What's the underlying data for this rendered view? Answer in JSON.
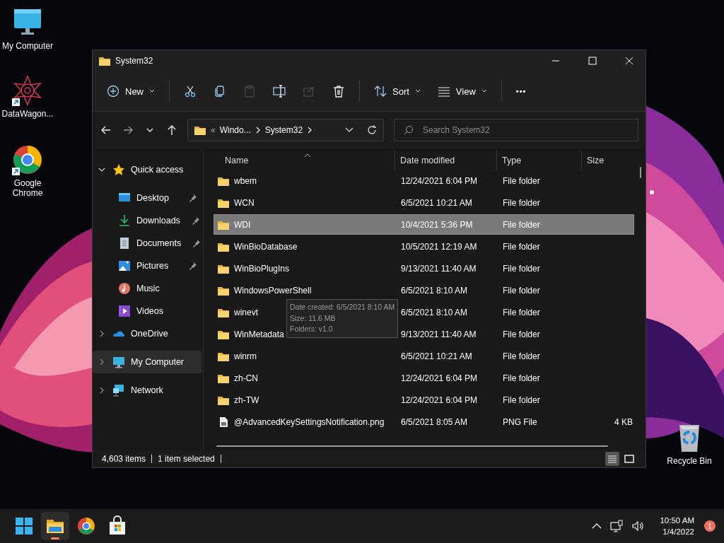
{
  "desktop_icons": [
    {
      "label": "My Computer",
      "shortcut": false
    },
    {
      "label": "DataWagon...",
      "shortcut": true
    },
    {
      "label": "Google Chrome",
      "shortcut": true
    },
    {
      "label": "Recycle Bin",
      "shortcut": false
    }
  ],
  "window": {
    "title": "System32",
    "toolbar": [
      {
        "label": "New",
        "menu": true,
        "disabled": false
      },
      {
        "menu": false,
        "disabled": false
      },
      {
        "menu": false,
        "disabled": false
      },
      {
        "menu": false,
        "disabled": true
      },
      {
        "menu": false,
        "disabled": false
      },
      {
        "menu": false,
        "disabled": true
      },
      {
        "menu": false,
        "disabled": false
      },
      {
        "label": "Sort",
        "menu": true,
        "disabled": false
      },
      {
        "label": "View",
        "menu": true,
        "disabled": false
      },
      {
        "label": "•••",
        "menu": false,
        "disabled": false
      }
    ],
    "address": {
      "overflow": "«",
      "segments": [
        "Windo...",
        "System32"
      ]
    },
    "search": {
      "placeholder": "Search System32"
    },
    "sidebar": [
      {
        "label": "Quick access",
        "expanded": true,
        "selected": false,
        "children": [
          {
            "label": "Desktop",
            "pinned": true,
            "selected": false
          },
          {
            "label": "Downloads",
            "pinned": true,
            "selected": false
          },
          {
            "label": "Documents",
            "pinned": true,
            "selected": false
          },
          {
            "label": "Pictures",
            "pinned": true,
            "selected": false
          },
          {
            "label": "Music",
            "pinned": false,
            "selected": false
          },
          {
            "label": "Videos",
            "pinned": false,
            "selected": false
          }
        ]
      },
      {
        "label": "OneDrive",
        "expanded": false,
        "selected": false
      },
      {
        "label": "My Computer",
        "expanded": false,
        "selected": true
      },
      {
        "label": "Network",
        "expanded": false,
        "selected": false
      }
    ],
    "table": {
      "columns": [
        "Name",
        "Date modified",
        "Type",
        "Size"
      ],
      "rows": [
        {
          "kind": "folder",
          "name": "wbem",
          "date": "12/24/2021 6:04 PM",
          "type": "File folder",
          "selected": false
        },
        {
          "kind": "folder",
          "name": "WCN",
          "date": "6/5/2021 10:21 AM",
          "type": "File folder",
          "selected": false
        },
        {
          "kind": "folder",
          "name": "WDI",
          "date": "10/4/2021 5:36 PM",
          "type": "File folder",
          "selected": true
        },
        {
          "kind": "folder",
          "name": "WinBioDatabase",
          "date": "10/5/2021 12:19 AM",
          "type": "File folder",
          "selected": false
        },
        {
          "kind": "folder",
          "name": "WinBioPlugIns",
          "date": "9/13/2021 11:40 AM",
          "type": "File folder",
          "selected": false
        },
        {
          "kind": "folder",
          "name": "WindowsPowerShell",
          "date": "6/5/2021 8:10 AM",
          "type": "File folder",
          "selected": false
        },
        {
          "kind": "folder",
          "name": "winevt",
          "date": "6/5/2021 8:10 AM",
          "type": "File folder",
          "selected": false
        },
        {
          "kind": "folder",
          "name": "WinMetadata",
          "date": "9/13/2021 11:40 AM",
          "type": "File folder",
          "selected": false
        },
        {
          "kind": "folder",
          "name": "winrm",
          "date": "6/5/2021 10:21 AM",
          "type": "File folder",
          "selected": false
        },
        {
          "kind": "folder",
          "name": "zh-CN",
          "date": "12/24/2021 6:04 PM",
          "type": "File folder",
          "selected": false
        },
        {
          "kind": "folder",
          "name": "zh-TW",
          "date": "12/24/2021 6:04 PM",
          "type": "File folder",
          "selected": false
        },
        {
          "kind": "file",
          "name": "@AdvancedKeySettingsNotification.png",
          "date": "6/5/2021 8:05 AM",
          "type": "PNG File",
          "size": "4 KB",
          "selected": false
        }
      ]
    },
    "tooltip": [
      "Date created: 6/5/2021 8:10 AM",
      "Size: 11.6 MB",
      "Folders: v1.0"
    ],
    "status_bar": {
      "items": [
        "4,603 items",
        "1 item selected"
      ],
      "views": [
        {
          "selected": true
        },
        {
          "selected": false
        }
      ]
    }
  },
  "taskbar": {
    "apps": [
      {
        "selected": false
      },
      {
        "selected": true
      },
      {
        "selected": false
      },
      {
        "selected": false
      }
    ],
    "time": "10:50 AM",
    "date": "1/4/2022",
    "badge": "1"
  }
}
